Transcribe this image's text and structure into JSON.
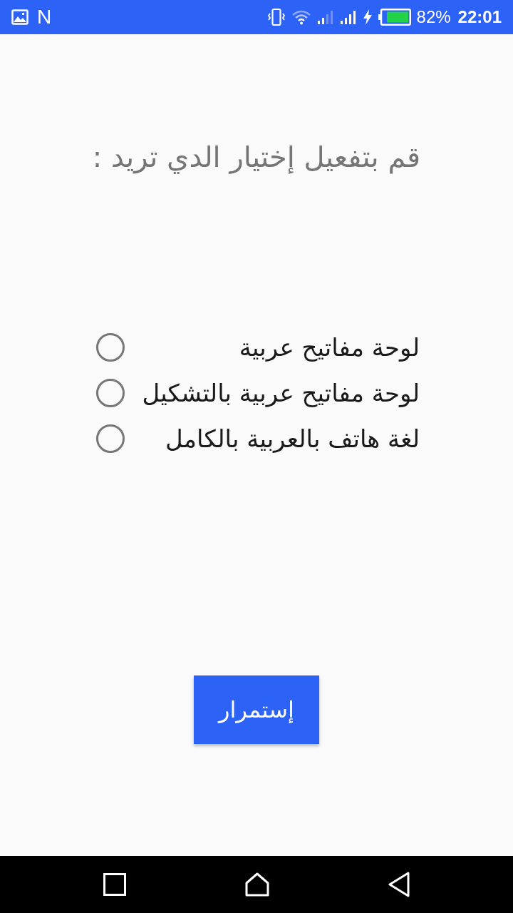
{
  "status_bar": {
    "notification_letter": "N",
    "battery_percent": "82%",
    "time": "22:01"
  },
  "prompt": "قم بتفعيل إختيار الدي تريد :",
  "options": [
    {
      "label": "لوحة مفاتيح عربية",
      "selected": false
    },
    {
      "label": "لوحة مفاتيح عربية بالتشكيل",
      "selected": false
    },
    {
      "label": "لغة هاتف بالعربية بالكامل",
      "selected": false
    }
  ],
  "continue_button": {
    "label": "إستمرار"
  }
}
